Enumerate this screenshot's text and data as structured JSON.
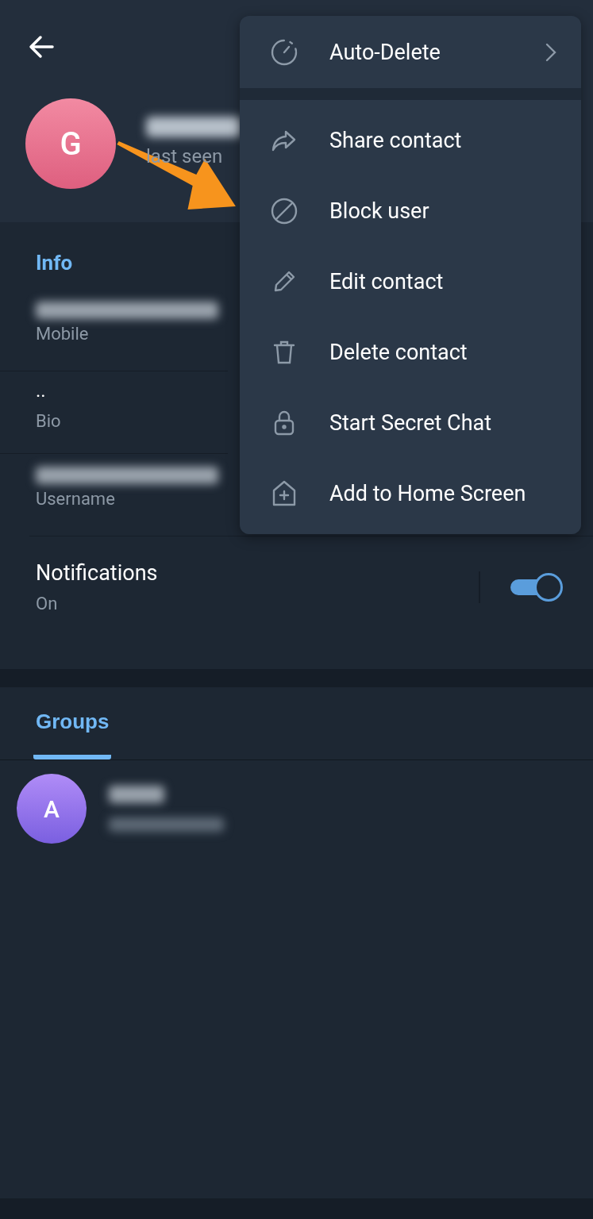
{
  "header": {
    "avatar_letter": "G",
    "status": "last seen"
  },
  "info": {
    "title": "Info",
    "fields": [
      {
        "kind": "redacted",
        "label": "Mobile"
      },
      {
        "kind": "text",
        "value": "..",
        "label": "Bio"
      },
      {
        "kind": "redacted",
        "label": "Username"
      }
    ]
  },
  "notifications": {
    "title": "Notifications",
    "status": "On",
    "on": true
  },
  "tabs": [
    {
      "label": "Groups",
      "selected": true
    }
  ],
  "groups": [
    {
      "avatar_letter": "A"
    }
  ],
  "menu": {
    "sections": [
      {
        "items": [
          {
            "label": "Auto-Delete",
            "kind": "timer",
            "submenu": true
          }
        ]
      },
      {
        "items": [
          {
            "label": "Share contact",
            "kind": "share",
            "submenu": false
          },
          {
            "label": "Block user",
            "kind": "block",
            "submenu": false
          },
          {
            "label": "Edit contact",
            "kind": "edit",
            "submenu": false
          },
          {
            "label": "Delete contact",
            "kind": "delete",
            "submenu": false
          },
          {
            "label": "Start Secret Chat",
            "kind": "lock",
            "submenu": false
          },
          {
            "label": "Add to Home Screen",
            "kind": "home",
            "submenu": false
          }
        ]
      }
    ]
  }
}
